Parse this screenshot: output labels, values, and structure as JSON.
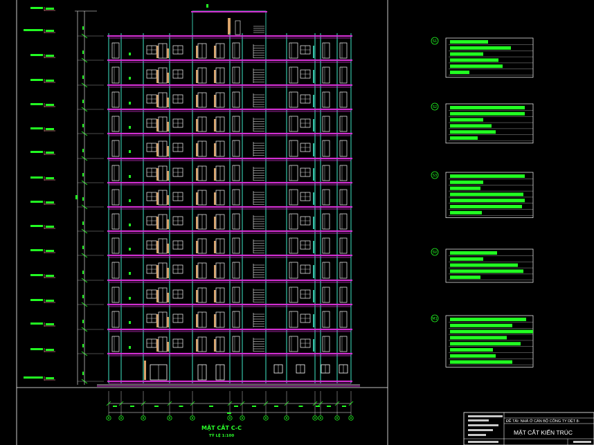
{
  "drawing": {
    "title": "MẶT CẮT C-C",
    "scale": "TỶ LỆ 1:100"
  },
  "title_block": {
    "project_line": "ĐỀ TÀI: NHÀ Ở CÁN BỘ CÔNG TY DỆT 8-",
    "sheet_name": "MẶT CẮT KIẾN TRÚC"
  },
  "layer_keys": [
    {
      "id": "s1",
      "symbol": "S1"
    },
    {
      "id": "s2",
      "symbol": "S2"
    },
    {
      "id": "s3",
      "symbol": "S3"
    },
    {
      "id": "sv",
      "symbol": "SV"
    },
    {
      "id": "m1",
      "symbol": "M1"
    }
  ],
  "colors": {
    "background": "#000000",
    "slab": "#d22fd2",
    "column": "#36c3a8",
    "annotation": "#22ff22",
    "door": "#d9a36a",
    "linework": "#ffffff"
  }
}
